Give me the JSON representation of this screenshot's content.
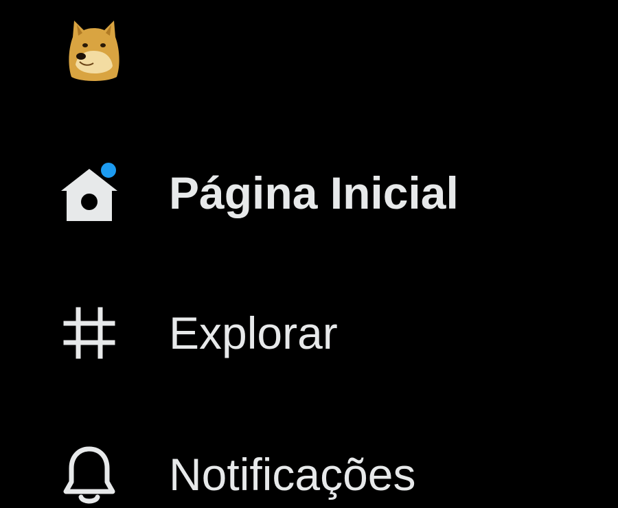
{
  "profile": {
    "avatar_icon": "doge-avatar-icon"
  },
  "nav": {
    "items": [
      {
        "label": "Página Inicial",
        "icon": "home-icon",
        "active": true,
        "has_notification_dot": true
      },
      {
        "label": "Explorar",
        "icon": "hashtag-icon",
        "active": false,
        "has_notification_dot": false
      },
      {
        "label": "Notificações",
        "icon": "bell-icon",
        "active": false,
        "has_notification_dot": false
      }
    ]
  },
  "colors": {
    "background": "#000000",
    "text": "#e7e9ea",
    "accent": "#1d9bf0"
  }
}
